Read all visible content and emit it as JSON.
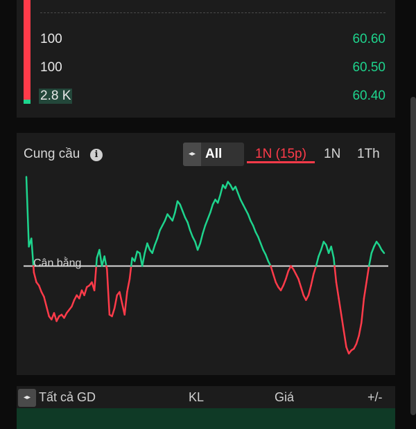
{
  "order_book": {
    "rows": [
      {
        "qty": "100",
        "price": "60.60",
        "highlight": false
      },
      {
        "qty": "100",
        "price": "60.50",
        "highlight": false
      },
      {
        "qty": "2.8 K",
        "price": "60.40",
        "highlight": true
      }
    ]
  },
  "supply_demand": {
    "title": "Cung cầu",
    "info_icon": "i",
    "range_arrows": "◂▸",
    "range_value": "All",
    "tabs": [
      {
        "label": "1N (15p)",
        "active": true
      },
      {
        "label": "1N",
        "active": false
      },
      {
        "label": "1Th",
        "active": false
      }
    ],
    "balance_label": "Cân bằng",
    "colors": {
      "above": "#1ed48d",
      "below": "#ff3b4a",
      "baseline": "#d8d8d8"
    }
  },
  "chart_data": {
    "type": "line",
    "baseline": 0,
    "ylim": [
      -60,
      57
    ],
    "values": [
      55,
      12,
      17,
      -4,
      -10,
      -12,
      -16,
      -19,
      -25,
      -31,
      -33,
      -29,
      -34,
      -31,
      -30,
      -32,
      -29,
      -27,
      -25,
      -21,
      -18,
      -20,
      -15,
      -18,
      -13,
      -12,
      -10,
      -15,
      5,
      10,
      0,
      6,
      -2,
      -30,
      -31,
      -26,
      -18,
      -16,
      -23,
      -30,
      -16,
      -8,
      5,
      3,
      9,
      8,
      0,
      8,
      14,
      10,
      8,
      13,
      17,
      22,
      25,
      28,
      32,
      30,
      28,
      33,
      40,
      38,
      34,
      30,
      27,
      22,
      18,
      15,
      10,
      14,
      20,
      25,
      29,
      33,
      38,
      41,
      39,
      44,
      50,
      48,
      52,
      50,
      47,
      49,
      45,
      41,
      38,
      35,
      32,
      28,
      25,
      21,
      18,
      14,
      10,
      7,
      3,
      0,
      -5,
      -10,
      -13,
      -15,
      -12,
      -8,
      -3,
      0,
      -2,
      -5,
      -8,
      -13,
      -18,
      -21,
      -18,
      -12,
      -5,
      0,
      6,
      10,
      15,
      13,
      8,
      12,
      5,
      -10,
      -20,
      -30,
      -40,
      -50,
      -54,
      -52,
      -51,
      -48,
      -43,
      -35,
      -20,
      -10,
      0,
      8,
      12,
      15,
      13,
      10,
      8
    ]
  },
  "trades": {
    "arrows": "◂▸",
    "headers": {
      "all": "Tất cả GD",
      "volume": "KL",
      "price": "Giá",
      "change": "+/-"
    }
  }
}
